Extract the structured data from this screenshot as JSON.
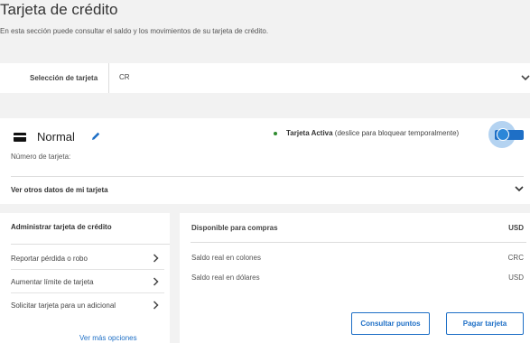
{
  "header": {
    "title": "Tarjeta de crédito",
    "subtitle": "En esta sección puede consultar el saldo y los movimientos de su tarjeta de crédito."
  },
  "selector": {
    "label": "Selección de tarjeta",
    "value": "CR"
  },
  "card": {
    "name": "Normal",
    "status_bold": "Tarjeta Activa",
    "status_rest": " (deslice para bloquear temporalmente)",
    "toggle_on": true,
    "number_label": "Número de tarjeta:",
    "more_data_label": "Ver otros datos de mi tarjeta"
  },
  "admin": {
    "title": "Administrar tarjeta de crédito",
    "items": [
      {
        "label": "Reportar pérdida o robo"
      },
      {
        "label": "Aumentar límite de tarjeta"
      },
      {
        "label": "Solicitar tarjeta para un adicional"
      }
    ],
    "more_options": "Ver más opciones"
  },
  "available": {
    "title": "Disponible para compras",
    "currency": "USD",
    "rows": [
      {
        "label": "Saldo real en colones",
        "currency": "CRC"
      },
      {
        "label": "Saldo real en dólares",
        "currency": "USD"
      }
    ],
    "buttons": {
      "points": "Consultar puntos",
      "pay": "Pagar tarjeta"
    }
  },
  "colors": {
    "accent": "#1e6fc6",
    "active_status": "#2e8b2e"
  }
}
